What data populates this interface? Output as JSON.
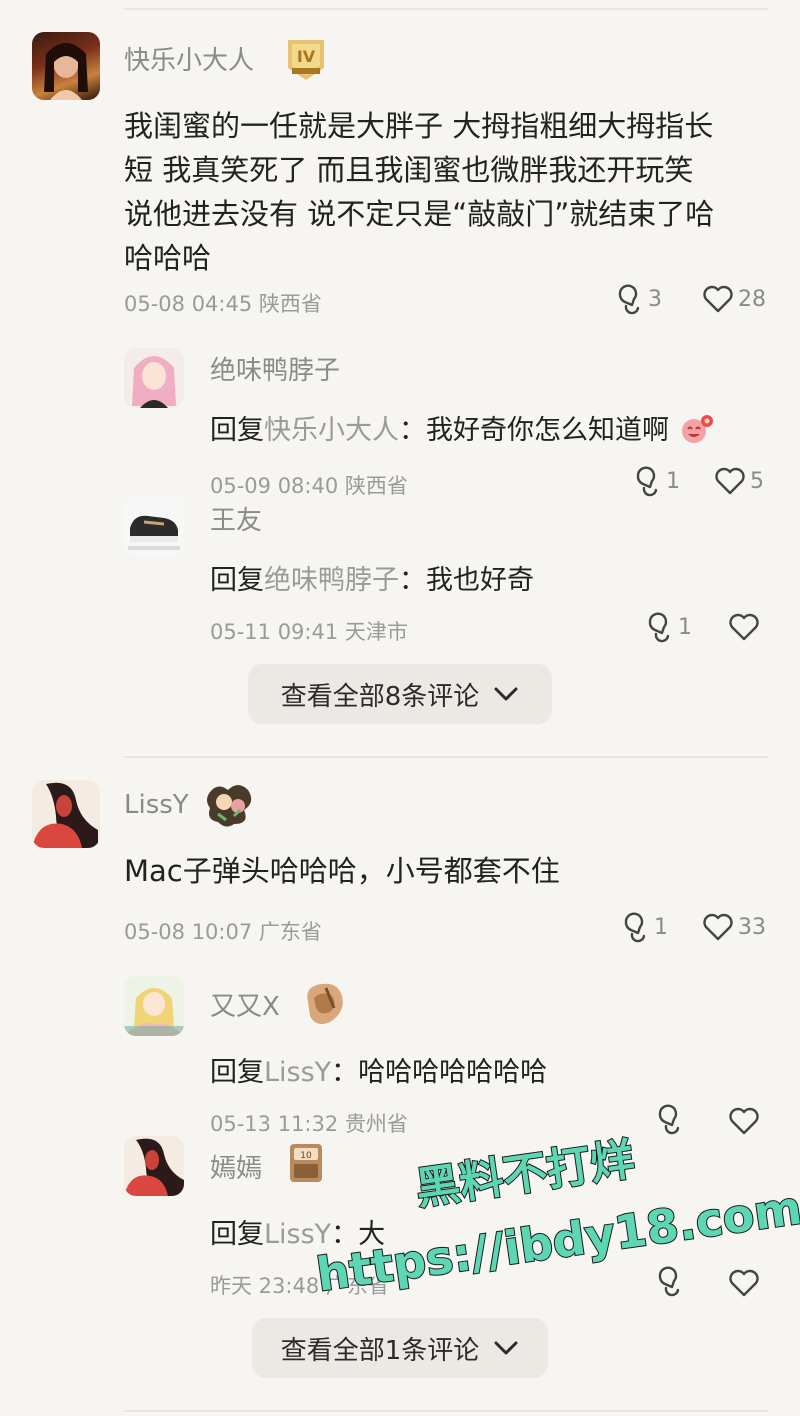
{
  "comments": [
    {
      "user": "快乐小大人",
      "badge": "level-badge",
      "text": "我闺蜜的一任就是大胖子  大拇指粗细大拇指长短  我真笑死了 而且我闺蜜也微胖我还开玩笑说他进去没有 说不定只是“敲敲门”就结束了哈哈哈哈",
      "lines": [
        "我闺蜜的一任就是大胖子  大拇指粗细大拇指长",
        "短  我真笑死了 而且我闺蜜也微胖我还开玩笑",
        "说他进去没有 说不定只是“敲敲门”就结束了哈",
        "哈哈哈"
      ],
      "time": "05-08 04:45 陕西省",
      "reply_count": "3",
      "like_count": "28",
      "replies": [
        {
          "user": "绝味鸭脖子",
          "prefix": "回复",
          "at": "快乐小大人",
          "text": "：我好奇你怎么知道啊",
          "emoji": "😂",
          "time": "05-09 08:40 陕西省",
          "reply_count": "1",
          "like_count": "5"
        },
        {
          "user": "王友",
          "prefix": "回复",
          "at": "绝味鸭脖子",
          "text": "：我也好奇",
          "time": "05-11 09:41 天津市",
          "reply_count": "1",
          "like_count": ""
        }
      ],
      "more_label": "查看全部8条评论"
    },
    {
      "user": "LissY",
      "badge": "flower-badge",
      "text": "Mac子弹头哈哈哈，小号都套不住",
      "time": "05-08 10:07 广东省",
      "reply_count": "1",
      "like_count": "33",
      "replies": [
        {
          "user": "又又X",
          "prefix": "回复",
          "at": "LissY",
          "text": "：哈哈哈哈哈哈哈",
          "time": "05-13 11:32 贵州省",
          "reply_count": "",
          "like_count": ""
        },
        {
          "user": "嫣嫣",
          "prefix": "回复",
          "at": "LissY",
          "text": "：大",
          "time": "昨天 23:48 广东省",
          "reply_count": "",
          "like_count": ""
        }
      ],
      "more_label": "查看全部1条评论"
    }
  ],
  "watermark": {
    "line1": "黑料不打烊",
    "line2": "https://ibdy18.com",
    "color": "#5cd6b3"
  }
}
